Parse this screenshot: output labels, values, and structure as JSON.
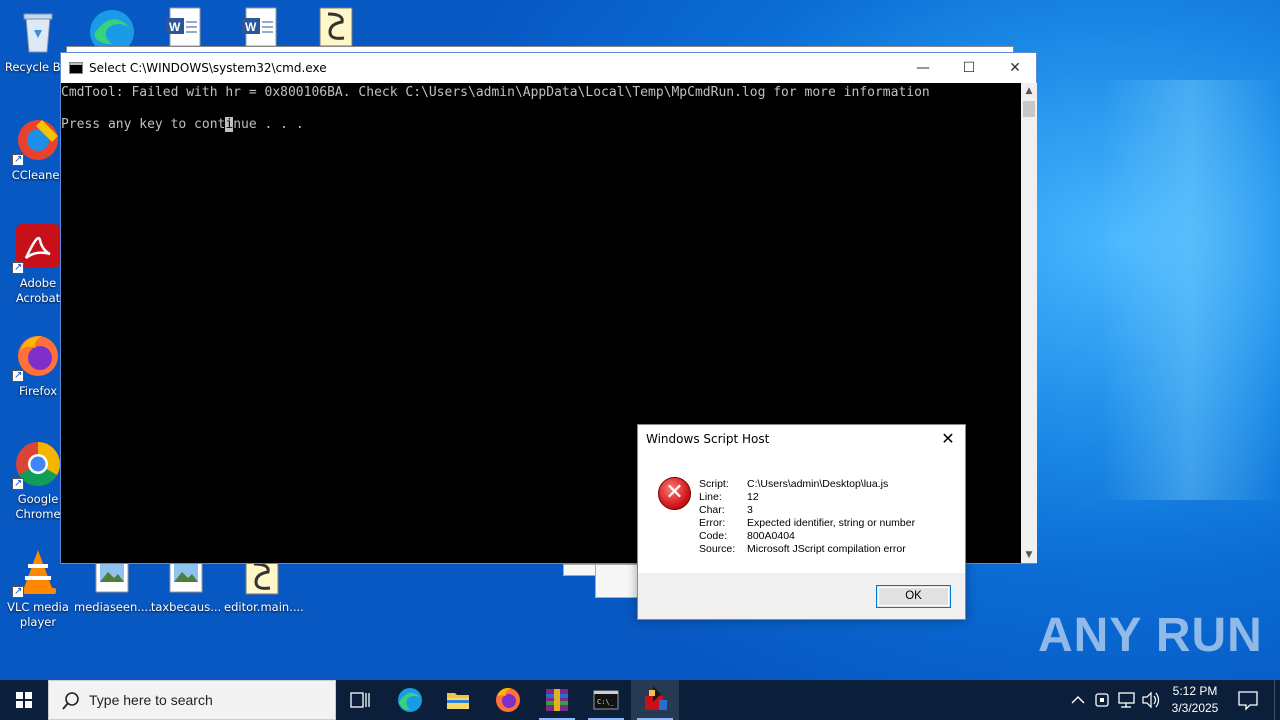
{
  "desktop": {
    "top_icons": [
      "edge-icon",
      "word-doc-icon",
      "word-doc-icon",
      "script-icon"
    ],
    "icons": [
      {
        "label": "Recycle Bin",
        "icon": "recycle-bin-icon"
      },
      {
        "label": "CCleaner",
        "icon": "ccleaner-icon"
      },
      {
        "label": "Adobe Acrobat",
        "icon": "adobe-acrobat-icon"
      },
      {
        "label": "Firefox",
        "icon": "firefox-icon"
      },
      {
        "label": "Google Chrome",
        "icon": "chrome-icon"
      },
      {
        "label": "VLC media player",
        "icon": "vlc-icon"
      },
      {
        "label": "mediaseen....",
        "icon": "image-file-icon"
      },
      {
        "label": "taxbecaus...",
        "icon": "image-file-icon"
      },
      {
        "label": "editor.main....",
        "icon": "script-icon"
      }
    ]
  },
  "cmd_window": {
    "title": "Select C:\\WINDOWS\\system32\\cmd.exe",
    "line1": "CmdTool: Failed with hr = 0x800106BA. Check C:\\Users\\admin\\AppData\\Local\\Temp\\MpCmdRun.log for more information",
    "line2_before": "Press any key to cont",
    "line2_cursor": "i",
    "line2_after": "nue . . .",
    "controls": {
      "minimize": "—",
      "maximize": "☐",
      "close": "✕"
    }
  },
  "dialog": {
    "title": "Windows Script Host",
    "close": "✕",
    "rows": [
      {
        "key": "Script:",
        "value": "C:\\Users\\admin\\Desktop\\lua.js"
      },
      {
        "key": "Line:",
        "value": "12"
      },
      {
        "key": "Char:",
        "value": "3"
      },
      {
        "key": "Error:",
        "value": "Expected identifier, string or number"
      },
      {
        "key": "Code:",
        "value": "800A0404"
      },
      {
        "key": "Source:",
        "value": "Microsoft JScript compilation error"
      }
    ],
    "ok_label": "OK"
  },
  "watermark": "ANY RUN",
  "taskbar": {
    "search_placeholder": "Type here to search",
    "apps": [
      "task-view-icon",
      "edge-icon",
      "file-explorer-icon",
      "firefox-icon",
      "winrar-icon",
      "cmd-icon",
      "script-host-icon"
    ],
    "time": "5:12 PM",
    "date": "3/3/2025"
  },
  "colors": {
    "accent": "#0078d7",
    "taskbar": "#0b1f3a",
    "console_bg": "#000000",
    "console_fg": "#c0c0c0"
  }
}
